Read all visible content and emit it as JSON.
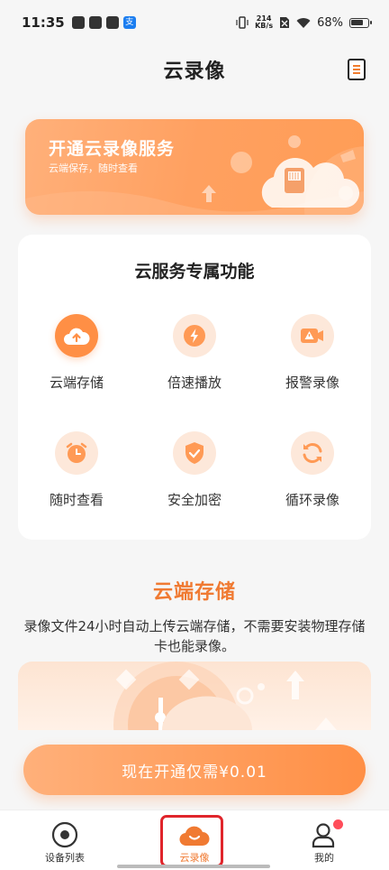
{
  "status_bar": {
    "time": "11:35",
    "net_speed_value": "214",
    "net_speed_unit": "KB/s",
    "battery": "68%"
  },
  "header": {
    "title": "云录像"
  },
  "banner": {
    "title": "开通云录像服务",
    "subtitle": "云端保存，随时查看"
  },
  "features_card": {
    "title": "云服务专属功能",
    "items": [
      {
        "label": "云端存储",
        "icon": "cloud-upload-icon"
      },
      {
        "label": "倍速播放",
        "icon": "lightning-icon"
      },
      {
        "label": "报警录像",
        "icon": "alarm-camera-icon"
      },
      {
        "label": "随时查看",
        "icon": "alarm-clock-icon"
      },
      {
        "label": "安全加密",
        "icon": "shield-check-icon"
      },
      {
        "label": "循环录像",
        "icon": "refresh-icon"
      }
    ]
  },
  "section": {
    "title": "云端存储",
    "description": "录像文件24小时自动上传云端存储，不需要安装物理存储卡也能录像。"
  },
  "cta": {
    "label": "现在开通仅需¥0.01"
  },
  "bottom_nav": {
    "items": [
      {
        "label": "设备列表",
        "icon": "camera-lens-icon",
        "active": false
      },
      {
        "label": "云录像",
        "icon": "cloud-smile-icon",
        "active": true
      },
      {
        "label": "我的",
        "icon": "user-icon",
        "active": false
      }
    ]
  },
  "colors": {
    "accent": "#ff8f45",
    "accent_text": "#f07a32",
    "highlight": "#e0252b",
    "badge": "#ff4d5a"
  }
}
